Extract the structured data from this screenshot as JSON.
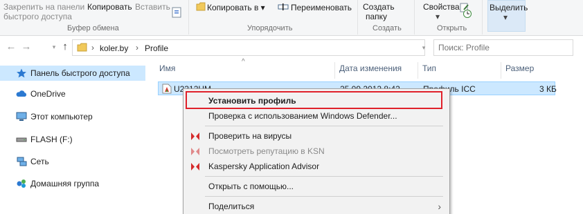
{
  "ribbon": {
    "pin_label_line1": "Закрепить на панели",
    "pin_label_line2": "быстрого доступа",
    "copy_label": "Копировать",
    "paste_label": "Вставить",
    "clipboard_group": "Буфер обмена",
    "copy_to_label": "Копировать в",
    "move_to_label": "Переименовать",
    "organize_group": "Упорядочить",
    "new_folder_line1": "Создать",
    "new_folder_line2": "папку",
    "new_group": "Создать",
    "properties_label": "Свойства",
    "open_group": "Открыть",
    "select_label": "Выделить"
  },
  "address": {
    "crumbs": [
      "koler.by",
      "Profile"
    ],
    "search_placeholder": "Поиск: Profile"
  },
  "sidebar": {
    "items": [
      {
        "label": "Панель быстрого доступа",
        "icon": "star-icon"
      },
      {
        "label": "OneDrive",
        "icon": "cloud-icon"
      },
      {
        "label": "Этот компьютер",
        "icon": "monitor-icon"
      },
      {
        "label": "FLASH (F:)",
        "icon": "drive-icon"
      },
      {
        "label": "Сеть",
        "icon": "network-icon"
      },
      {
        "label": "Домашняя группа",
        "icon": "homegroup-icon"
      }
    ]
  },
  "columns": [
    "Имя",
    "Дата изменения",
    "Тип",
    "Размер"
  ],
  "file": {
    "name": "U2312HM",
    "date": "25.09.2012 8:42",
    "type": "Профиль ICC",
    "size": "3 КБ"
  },
  "context_menu": {
    "items": [
      {
        "label": "Установить профиль"
      },
      {
        "label": "Проверка с использованием Windows Defender..."
      },
      {
        "label": "Проверить на вирусы"
      },
      {
        "label": "Посмотреть репутацию в KSN"
      },
      {
        "label": "Kaspersky Application Advisor"
      },
      {
        "label": "Открыть с помощью..."
      },
      {
        "label": "Поделиться"
      }
    ]
  },
  "colors": {
    "selection": "#cce8ff",
    "highlight_outline": "#e0202a",
    "kaspersky_red": "#d52b2b"
  }
}
